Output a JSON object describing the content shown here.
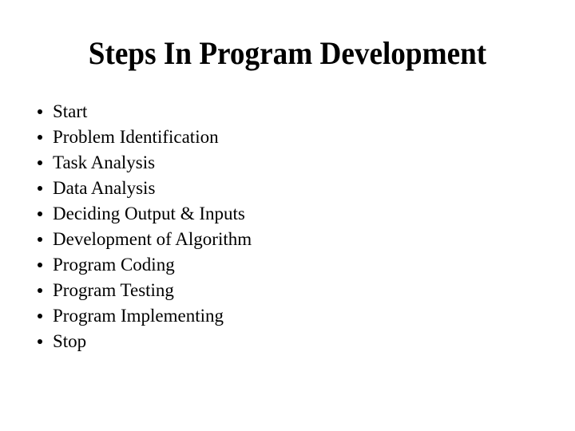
{
  "slide": {
    "title": "Steps In Program Development",
    "background_color": "#ffffff",
    "text_color": "#000000",
    "bullet_glyph": "bullet-dot",
    "items": [
      {
        "label": "Start"
      },
      {
        "label": "Problem Identification"
      },
      {
        "label": "Task Analysis"
      },
      {
        "label": "Data Analysis"
      },
      {
        "label": "Deciding Output & Inputs"
      },
      {
        "label": "Development of Algorithm"
      },
      {
        "label": "Program Coding"
      },
      {
        "label": "Program Testing"
      },
      {
        "label": "Program Implementing"
      },
      {
        "label": "Stop"
      }
    ]
  }
}
